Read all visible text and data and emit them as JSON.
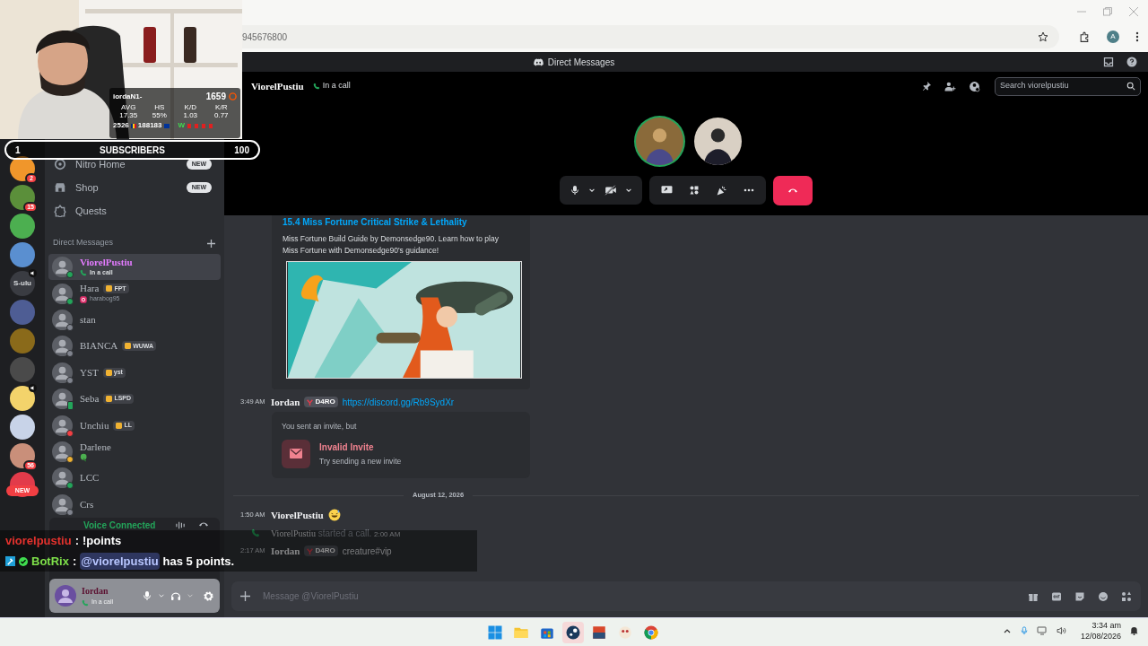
{
  "browser": {
    "url": "945676800",
    "profile": "A"
  },
  "webcam": {
    "kind": "picture",
    "stats": {
      "player": "iordaN1-",
      "rating": "1659",
      "labels": [
        "AVG",
        "HS",
        "K/D",
        "K/R"
      ],
      "values": [
        "17.35",
        "55%",
        "1.03",
        "0.77"
      ],
      "rank": "2526",
      "points": "188183",
      "form": "W"
    }
  },
  "subscribers": {
    "rank": "1",
    "label": "SUBSCRIBERS",
    "count": "100"
  },
  "titlebar": {
    "title": "Direct Messages"
  },
  "servers": [
    {
      "color": "#f0962b",
      "badge": "2"
    },
    {
      "color": "#5b8f3a",
      "badge": "15"
    },
    {
      "color": "#4caf50"
    },
    {
      "color": "#5a8fd0"
    },
    {
      "color": "#3a3c42",
      "label": "S-ulu",
      "speaker": true
    },
    {
      "color": "#4e5d94"
    },
    {
      "color": "#8a6a1a"
    },
    {
      "color": "#4a4a4a"
    },
    {
      "color": "#f3d36b",
      "speaker": true
    },
    {
      "color": "#c8d3e8"
    },
    {
      "color": "#c98f7a",
      "badge": "56"
    },
    {
      "color": "#e23b4a",
      "pill": "NEW"
    }
  ],
  "sidebar": {
    "nav": [
      {
        "label": "Nitro Home",
        "kind": "nitro",
        "badge": "NEW"
      },
      {
        "label": "Shop",
        "kind": "shop",
        "badge": "NEW"
      },
      {
        "label": "Quests",
        "kind": "quests"
      }
    ],
    "section": "Direct Messages",
    "dms": [
      {
        "name": "ViorelPustiu",
        "selected": true,
        "color": "#23a55a",
        "sub": {
          "kind": "call",
          "text": "In a call"
        }
      },
      {
        "name": "Hara",
        "selected": false,
        "color": "#23a55a",
        "tag": "FPT",
        "sub": {
          "kind": "instagram",
          "text": "harabog95"
        }
      },
      {
        "name": "stan",
        "selected": false,
        "color": "#80848e"
      },
      {
        "name": "BIANCA",
        "selected": false,
        "color": "#80848e",
        "tag": "WUWA"
      },
      {
        "name": "YST",
        "selected": false,
        "color": "#80848e",
        "tag": "yst"
      },
      {
        "name": "Seba",
        "selected": false,
        "color": "#23a55a",
        "tag": "LSPD",
        "mobile": true
      },
      {
        "name": "Unchiu",
        "selected": false,
        "color": "#f23f43",
        "tag": "LL"
      },
      {
        "name": "Darlene",
        "selected": false,
        "color": "#f0b232",
        "sub": {
          "kind": "emoji"
        }
      },
      {
        "name": "LCC",
        "selected": false,
        "color": "#23a55a"
      },
      {
        "name": "Crs",
        "selected": false,
        "color": "#80848e"
      }
    ]
  },
  "voice": {
    "label": "Voice Connected"
  },
  "user_panel": {
    "name": "Iordan",
    "status": "In a call"
  },
  "call": {
    "name": "ViorelPustiu",
    "status": "In a call",
    "search_placeholder": "Search viorelpustiu",
    "participants": [
      {
        "speaking": true
      },
      {
        "speaking": false
      }
    ]
  },
  "chat": {
    "embed": {
      "title": "15.4 Miss Fortune Critical Strike & Lethality",
      "description": "Miss Fortune Build Guide by Demonsedge90. Learn how to play Miss Fortune with Demonsedge90's guidance!"
    },
    "messages": [
      {
        "kind": "message",
        "time": "3:49 AM",
        "author": "Iordan",
        "tag": "D4RO",
        "link": "https://discord.gg/Rb9SydXr"
      },
      {
        "kind": "invite",
        "intro": "You sent an invite, but",
        "title": "Invalid Invite",
        "subtitle": "Try sending a new invite"
      },
      {
        "kind": "divider",
        "label": "August 12, 2026"
      },
      {
        "kind": "message",
        "time": "1:50 AM",
        "author": "ViorelPustiu",
        "emoji": true
      },
      {
        "kind": "call",
        "author": "ViorelPustiu",
        "text": "started a call.",
        "time": "2:00 AM"
      },
      {
        "kind": "message",
        "time": "2:17 AM",
        "author": "Iordan",
        "tag": "D4RO",
        "text": "creature#vip"
      }
    ],
    "composer_placeholder": "Message @ViorelPustiu"
  },
  "stream_chat": [
    {
      "user": "viorelpustiu",
      "color": "#e5322d",
      "separator": ":",
      "message": "!points"
    },
    {
      "user": "BotRix",
      "color": "#7ee04a",
      "badges": true,
      "separator": ":",
      "mention": "@viorelpustiu",
      "message": "has 5 points."
    }
  ],
  "taskbar": {
    "time": "3:34 am",
    "date": "12/08/2026"
  }
}
